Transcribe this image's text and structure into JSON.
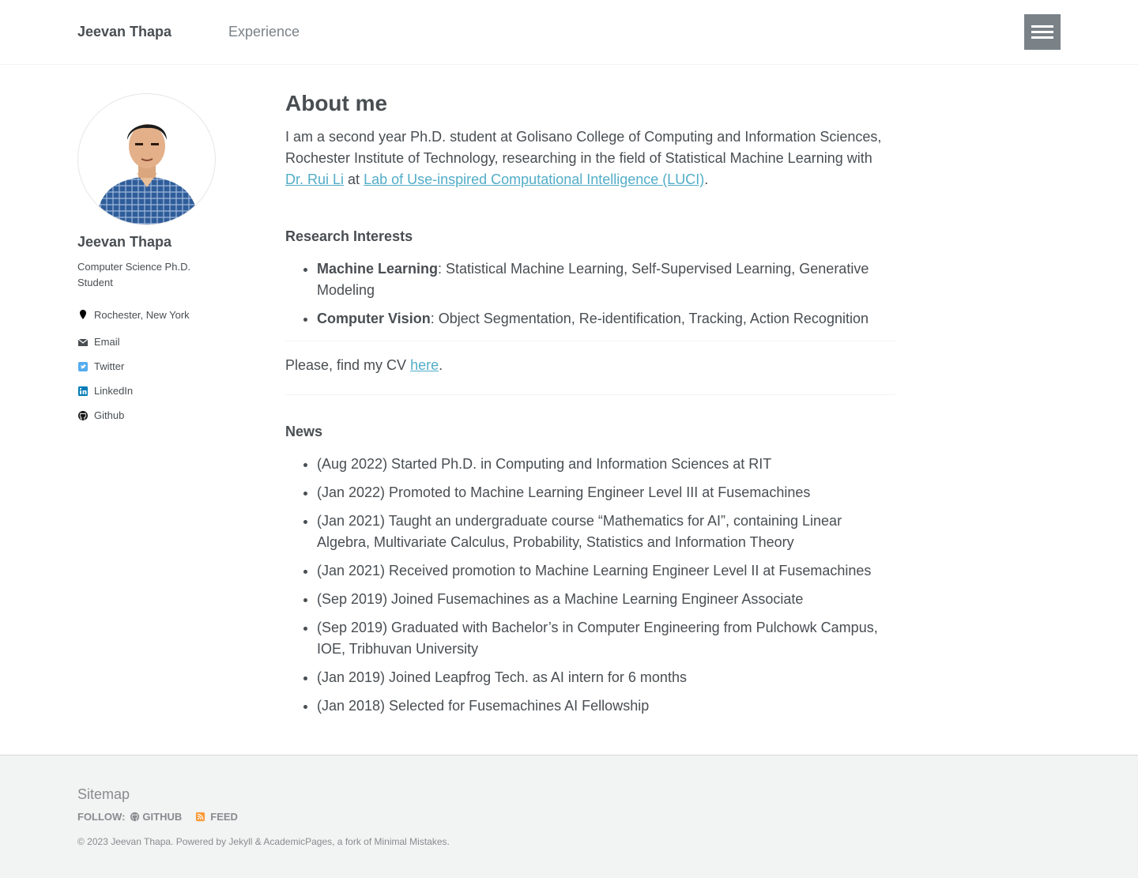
{
  "header": {
    "site_title": "Jeevan Thapa",
    "nav": [
      {
        "label": "Experience"
      }
    ]
  },
  "sidebar": {
    "name": "Jeevan Thapa",
    "bio": "Computer Science Ph.D. Student",
    "links": [
      {
        "label": "Rochester, New York",
        "icon": "map-marker-icon"
      },
      {
        "label": "Email",
        "icon": "envelope-icon"
      },
      {
        "label": "Twitter",
        "icon": "twitter-icon"
      },
      {
        "label": "LinkedIn",
        "icon": "linkedin-icon"
      },
      {
        "label": "Github",
        "icon": "github-icon"
      }
    ]
  },
  "main": {
    "title": "About me",
    "intro": "I am a second year Ph.D. student at Golisano College of Computing and Information Sciences, Rochester Institute of Technology, researching in the field of Statistical Machine Learning with",
    "advisor_link": "Dr. Rui Li",
    "at_text": "at",
    "lab_link": "Lab of Use-inspired Computational Intelligence (LUCI)",
    "period": ".",
    "research_heading": "Research Interests",
    "research": [
      {
        "term": "Machine Learning",
        "desc": ": Statistical Machine Learning, Self-Supervised Learning, Generative Modeling"
      },
      {
        "term": "Computer Vision",
        "desc": ": Object Segmentation, Re-identification, Tracking, Action Recognition"
      }
    ],
    "cv_text": "Please, find my CV",
    "cv_link": "here",
    "news_heading": "News",
    "news": [
      "(Aug 2022) Started Ph.D. in Computing and Information Sciences at RIT",
      "(Jan 2022) Promoted to Machine Learning Engineer Level III at Fusemachines",
      "(Jan 2021) Taught an undergraduate course “Mathematics for AI”, containing Linear Algebra, Multivariate Calculus, Probability, Statistics and Information Theory",
      "(Jan 2021) Received promotion to Machine Learning Engineer Level II at Fusemachines",
      "(Sep 2019) Joined Fusemachines as a Machine Learning Engineer Associate",
      "(Sep 2019) Graduated with Bachelor’s in Computer Engineering from Pulchowk Campus, IOE, Tribhuvan University",
      "(Jan 2019) Joined Leapfrog Tech. as AI intern for 6 months",
      "(Jan 2018) Selected for Fusemachines AI Fellowship"
    ]
  },
  "footer": {
    "sitemap": "Sitemap",
    "follow_label": "FOLLOW:",
    "github_label": "GITHUB",
    "feed_label": "FEED",
    "copyright": "© 2023 Jeevan Thapa. Powered by Jekyll & AcademicPages, a fork of Minimal Mistakes."
  },
  "colors": {
    "link": "#52adc8",
    "text": "#494e52",
    "muted": "#7a8288",
    "twitter": "#55acee",
    "linkedin": "#007bb6",
    "feed": "#fa9b39"
  }
}
